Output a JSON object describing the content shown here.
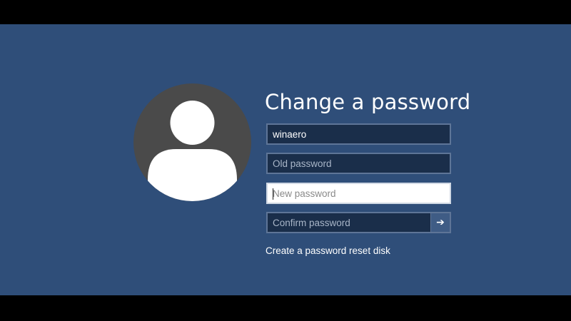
{
  "screen": {
    "title": "Change a password",
    "background_color": "#2f4e79"
  },
  "avatar": {
    "icon": "user-avatar-icon"
  },
  "form": {
    "username_value": "winaero",
    "old_password_placeholder": "Old password",
    "new_password_placeholder": "New password",
    "confirm_password_placeholder": "Confirm password",
    "submit_icon": "arrow-right-icon",
    "submit_glyph": "➔"
  },
  "links": {
    "reset_disk": "Create a password reset disk"
  }
}
